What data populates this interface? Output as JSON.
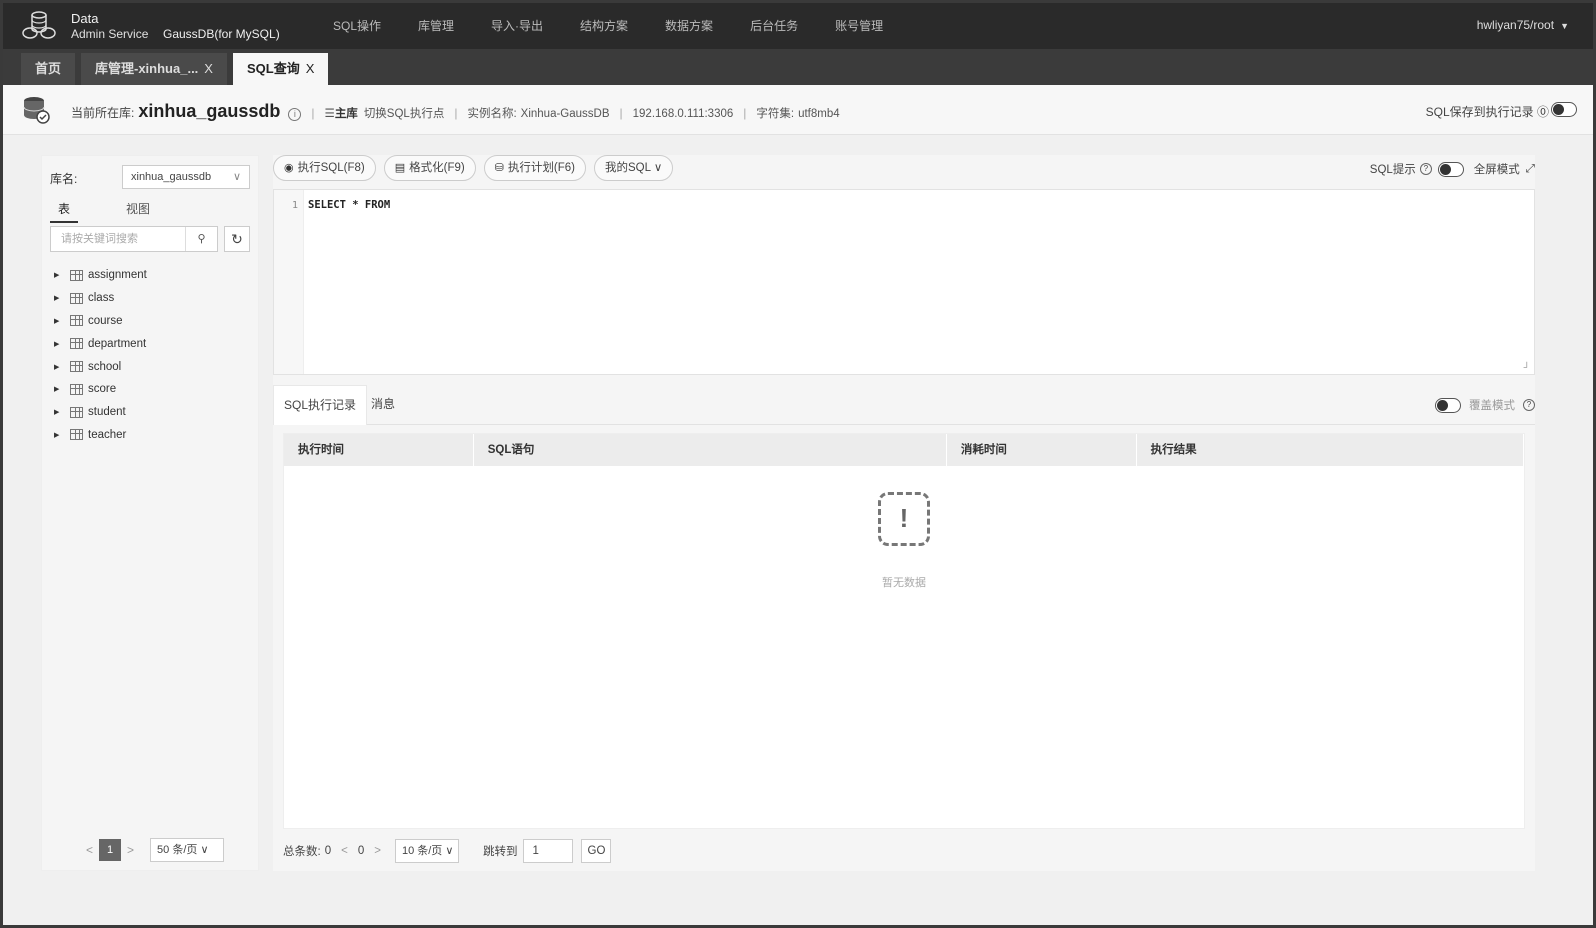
{
  "brand": {
    "line1": "Data",
    "line2": "Admin Service",
    "product": "GaussDB(for MySQL)"
  },
  "menu": [
    "SQL操作",
    "库管理",
    "导入·导出",
    "结构方案",
    "数据方案",
    "后台任务",
    "账号管理"
  ],
  "user": "hwliyan75/root",
  "tabs": [
    {
      "label": "首页"
    },
    {
      "label": "库管理-xinhua_...",
      "close": "X"
    },
    {
      "label": "SQL查询",
      "close": "X"
    }
  ],
  "info": {
    "current_db_label": "当前所在库:",
    "current_db": "xinhua_gaussdb",
    "master_label": "主库",
    "switch_label": "切换SQL执行点",
    "instance_label": "实例名称:",
    "instance": "Xinhua-GaussDB",
    "address": "192.168.0.111:3306",
    "charset_label": "字符集:",
    "charset": "utf8mb4",
    "save_record": "SQL保存到执行记录"
  },
  "left": {
    "db_label": "库名:",
    "db_value": "xinhua_gaussdb",
    "tab_table": "表",
    "tab_view": "视图",
    "search_placeholder": "请按关键词搜索",
    "tables": [
      "assignment",
      "class",
      "course",
      "department",
      "school",
      "score",
      "student",
      "teacher"
    ],
    "page": "1",
    "page_size": "50 条/页"
  },
  "toolbar": {
    "run": "执行SQL(F8)",
    "format": "格式化(F9)",
    "plan": "执行计划(F6)",
    "my_sql": "我的SQL",
    "sql_hint": "SQL提示",
    "fullscreen": "全屏模式"
  },
  "editor": {
    "line": "1",
    "code": "SELECT * FROM"
  },
  "results": {
    "tab_history": "SQL执行记录",
    "tab_message": "消息",
    "cover_mode": "覆盖模式",
    "columns": [
      "执行时间",
      "SQL语句",
      "消耗时间",
      "执行结果"
    ],
    "empty_text": "暂无数据"
  },
  "pager": {
    "total_label": "总条数:",
    "total": "0",
    "current": "0",
    "page_size": "10 条/页",
    "goto_label": "跳转到",
    "goto_value": "1",
    "go": "GO"
  }
}
